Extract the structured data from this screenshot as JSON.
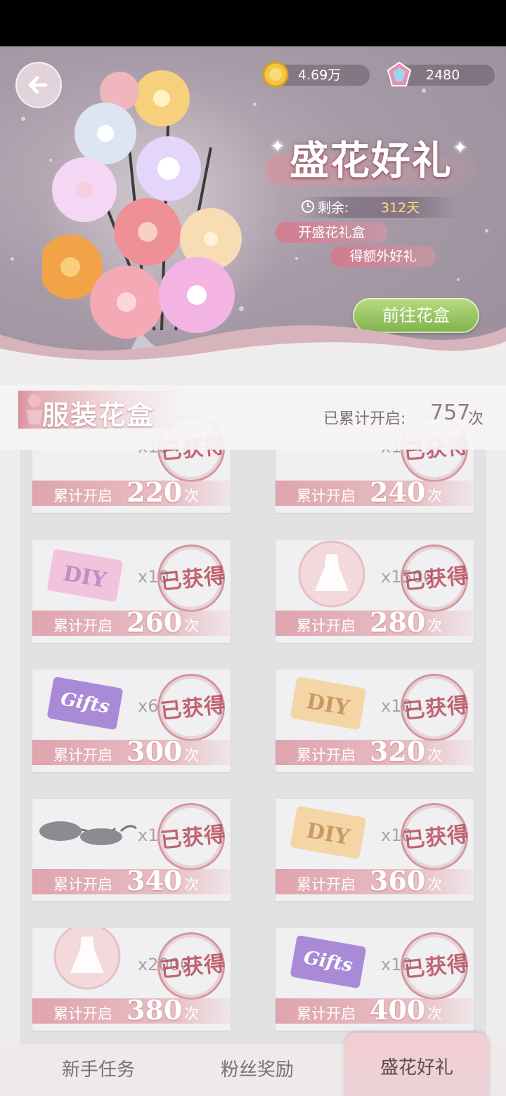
{
  "header": {
    "back_icon": "arrow-left-icon",
    "coins": {
      "icon": "coin-icon",
      "value": "4.69万"
    },
    "gems": {
      "icon": "gem-icon",
      "value": "2480"
    }
  },
  "event": {
    "title": "盛花好礼",
    "remaining_label": "剩余:",
    "remaining_value": "312天",
    "pill_open": "开盛花礼盒",
    "pill_extra": "得额外好礼",
    "go_button": "前往花盒"
  },
  "section": {
    "title": "服装花盒",
    "opened_label": "已累计开启:",
    "opened_value": "757",
    "opened_unit": "次"
  },
  "rewards": {
    "bar_label": "累计开启",
    "bar_unit": "次",
    "stamp": "已获得",
    "items": [
      {
        "count": "220",
        "qty": "x10",
        "icon": "voucher-icon"
      },
      {
        "count": "240",
        "qty": "x1",
        "icon": "strawberry-icon"
      },
      {
        "count": "260",
        "qty": "x10",
        "icon": "diy-card-icon"
      },
      {
        "count": "280",
        "qty": "x1500",
        "icon": "dress-orb-icon"
      },
      {
        "count": "300",
        "qty": "x6",
        "icon": "gifts-card-icon"
      },
      {
        "count": "320",
        "qty": "x10",
        "icon": "diy-card-gold-icon"
      },
      {
        "count": "340",
        "qty": "x1",
        "icon": "sunglasses-icon"
      },
      {
        "count": "360",
        "qty": "x10",
        "icon": "diy-card-gold-icon"
      },
      {
        "count": "380",
        "qty": "x2000",
        "icon": "dress-orb-icon"
      },
      {
        "count": "400",
        "qty": "x10",
        "icon": "gifts-card-icon"
      }
    ]
  },
  "nav": {
    "tabs": [
      {
        "label": "新手任务"
      },
      {
        "label": "粉丝奖励"
      },
      {
        "label": "盛花好礼"
      }
    ]
  }
}
